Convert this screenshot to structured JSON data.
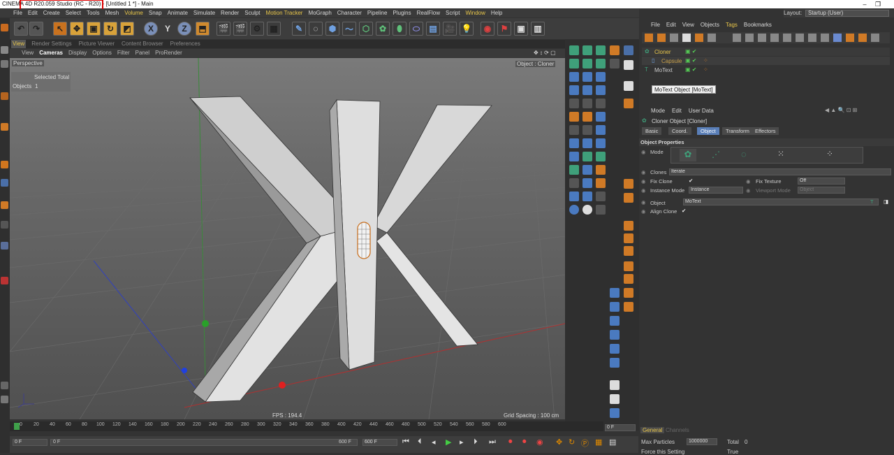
{
  "titlebar": {
    "title": "CINEMA 4D R20.059 Studio (RC - R20) - [Untitled 1 *] - Main",
    "minimize": "–",
    "restore": "❐"
  },
  "menubar": {
    "items": [
      "File",
      "Edit",
      "Create",
      "Select",
      "Tools",
      "Mesh",
      "Volume",
      "Snap",
      "Animate",
      "Simulate",
      "Render",
      "Sculpt",
      "Motion Tracker",
      "MoGraph",
      "Character",
      "Pipeline",
      "Plugins",
      "RealFlow",
      "Script",
      "Window",
      "Help"
    ],
    "layout_label": "Layout:",
    "layout_value": "Startup (User)"
  },
  "viewport_tabs": [
    "View",
    "Render Settings",
    "Picture Viewer",
    "Content Browser",
    "Preferences"
  ],
  "viewport_menu": [
    "View",
    "Cameras",
    "Display",
    "Options",
    "Filter",
    "Panel",
    "ProRender"
  ],
  "viewport": {
    "camera": "Perspective",
    "object_label": "Object : Cloner",
    "selected_total": "Selected Total",
    "objects_label": "Objects",
    "objects_count": "1",
    "fps": "FPS : 194.4",
    "grid_spacing": "Grid Spacing : 100 cm"
  },
  "object_manager": {
    "menu": [
      "File",
      "Edit",
      "View",
      "Objects",
      "Tags",
      "Bookmarks"
    ],
    "tree": [
      {
        "name": "Cloner"
      },
      {
        "name": "Capsule"
      },
      {
        "name": "MoText"
      }
    ],
    "tooltip": "MoText Object [MoText]"
  },
  "attributes": {
    "menu": [
      "Mode",
      "Edit",
      "User Data"
    ],
    "object_title": "Cloner Object [Cloner]",
    "tabs": [
      "Basic",
      "Coord.",
      "Object",
      "Transform",
      "Effectors"
    ],
    "section": "Object Properties",
    "mode_label": "Mode",
    "clones_label": "Clones",
    "clones_value": "Iterate",
    "fix_clone_label": "Fix Clone",
    "fix_clone_check": "✔",
    "fix_texture_label": "Fix Texture",
    "fix_texture_value": "Off",
    "instance_mode_label": "Instance Mode",
    "instance_mode_value": "Instance",
    "viewport_mode_label": "Viewport Mode",
    "viewport_mode_value": "Object",
    "object_label": "Object",
    "object_value": "MoText",
    "align_clone_label": "Align Clone",
    "align_clone_check": "✔"
  },
  "timeline": {
    "ticks": [
      "0",
      "20",
      "40",
      "60",
      "80",
      "100",
      "120",
      "140",
      "160",
      "180",
      "200",
      "220",
      "240",
      "260",
      "280",
      "300",
      "320",
      "340",
      "360",
      "380",
      "400",
      "420",
      "440",
      "460",
      "480",
      "500",
      "520",
      "540",
      "560",
      "580",
      "600"
    ],
    "current_frame": "0 F"
  },
  "transport": {
    "start_field": "0 F",
    "min_field": "0 F",
    "max_field": "600 F",
    "end_field": "600 F"
  },
  "bottom_panel": {
    "tabs": [
      "General",
      "Channels"
    ],
    "max_particles_label": "Max Particles",
    "max_particles_value": "1000000",
    "total_label": "Total",
    "total_value": "0",
    "force_setting_label": "Force this Setting",
    "force_setting_value": "True"
  },
  "colors": {
    "accent": "#e8c64a",
    "highlight_box": "#dd0000",
    "active_tab": "#5a7fb8"
  }
}
